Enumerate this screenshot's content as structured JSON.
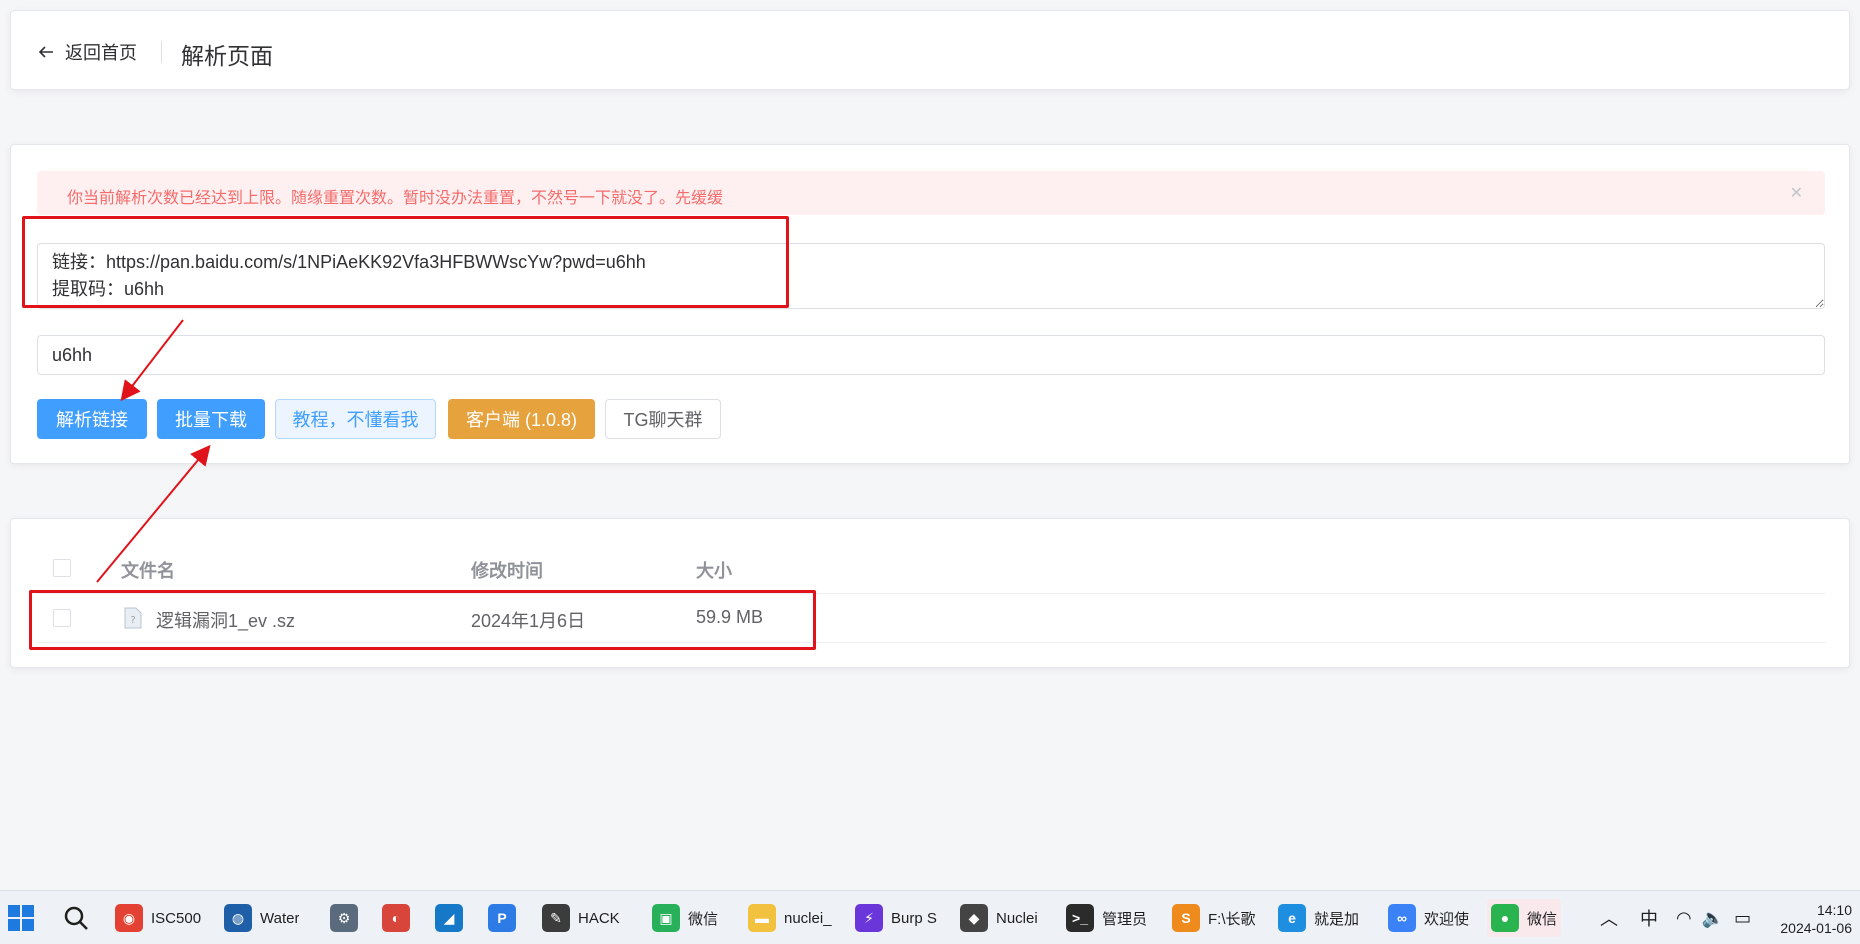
{
  "header": {
    "back_label": "返回首页",
    "title": "解析页面"
  },
  "alert": {
    "text": "你当前解析次数已经达到上限。随缘重置次数。暂时没办法重置，不然号一下就没了。先缓缓"
  },
  "link_input": {
    "value": "链接：https://pan.baidu.com/s/1NPiAeKK92Vfa3HFBWWscYw?pwd=u6hh\n提取码：u6hh"
  },
  "code_input": {
    "value": "u6hh"
  },
  "buttons": {
    "parse": "解析链接",
    "batch": "批量下载",
    "tutorial": "教程，不懂看我",
    "client": "客户端 (1.0.8)",
    "tg": "TG聊天群"
  },
  "file_table": {
    "headers": {
      "name": "文件名",
      "modified": "修改时间",
      "size": "大小"
    },
    "rows": [
      {
        "name": "逻辑漏洞1_ev .sz",
        "modified": "2024年1月6日",
        "size": "59.9 MB"
      }
    ]
  },
  "taskbar": {
    "items": [
      {
        "label": "ISC500",
        "icon": "chrome-icon",
        "color": "#e34133"
      },
      {
        "label": "Water",
        "icon": "waterfox-icon",
        "color": "#1f5fa8"
      },
      {
        "label": "",
        "icon": "tool-icon",
        "color": "#5a6b7d"
      },
      {
        "label": "",
        "icon": "snail-icon",
        "color": "#d8453a"
      },
      {
        "label": "",
        "icon": "wireshark-icon",
        "color": "#1679c7"
      },
      {
        "label": "",
        "icon": "p-app-icon",
        "color": "#2d7be5"
      },
      {
        "label": "HACK",
        "icon": "editor-icon",
        "color": "#3c3c3c"
      },
      {
        "label": "微信",
        "icon": "wechat-dev-icon",
        "color": "#28b05a"
      },
      {
        "label": "nuclei_",
        "icon": "folder-icon",
        "color": "#f2c13d"
      },
      {
        "label": "Burp S",
        "icon": "burp-icon",
        "color": "#6a35d9"
      },
      {
        "label": "Nuclei",
        "icon": "nuclei-icon",
        "color": "#444444"
      },
      {
        "label": "管理员",
        "icon": "terminal-icon",
        "color": "#2b2b2b"
      },
      {
        "label": "F:\\长歌",
        "icon": "sublime-icon",
        "color": "#ef8a1d"
      },
      {
        "label": "就是加",
        "icon": "edge-icon",
        "color": "#1d8ee0"
      },
      {
        "label": "欢迎使",
        "icon": "baidu-netdisk-icon",
        "color": "#3b82f6"
      },
      {
        "label": "微信",
        "icon": "wechat-icon",
        "color": "#2ab44f"
      }
    ],
    "tray": {
      "ime": "中",
      "time": "14:10",
      "date": "2024-01-06"
    }
  }
}
